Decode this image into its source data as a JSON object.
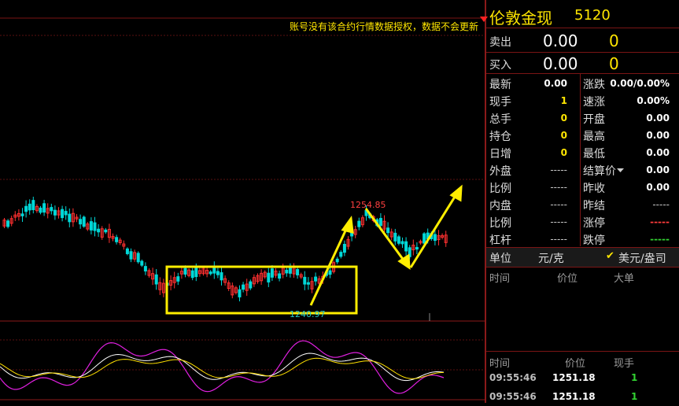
{
  "notice": "账号没有该合约行情数据授权，数据不会更新",
  "annotations": {
    "high_price": "1254.85",
    "low_price": "1240.97"
  },
  "quote": {
    "name": "伦敦金现",
    "code": "5120",
    "sell_label": "卖出",
    "sell_price": "0.00",
    "sell_volume": "0",
    "buy_label": "买入",
    "buy_price": "0.00",
    "buy_volume": "0"
  },
  "stats_left": [
    {
      "label": "最新",
      "value": "0.00",
      "color": "white"
    },
    {
      "label": "现手",
      "value": "1",
      "color": "yellow"
    },
    {
      "label": "总手",
      "value": "0",
      "color": "yellow"
    },
    {
      "label": "持仓",
      "value": "0",
      "color": "yellow"
    },
    {
      "label": "日增",
      "value": "0",
      "color": "yellow"
    },
    {
      "label": "外盘",
      "value": "-----",
      "color": "dash"
    },
    {
      "label": "比例",
      "value": "-----",
      "color": "dash"
    },
    {
      "label": "内盘",
      "value": "-----",
      "color": "dash"
    },
    {
      "label": "比例",
      "value": "-----",
      "color": "dash"
    },
    {
      "label": "杠杆",
      "value": "-----",
      "color": "dash"
    }
  ],
  "stats_right": [
    {
      "label": "涨跌",
      "value": "0.00/0.00%",
      "color": "white"
    },
    {
      "label": "速涨",
      "value": "0.00%",
      "color": "white"
    },
    {
      "label": "开盘",
      "value": "0.00",
      "color": "white"
    },
    {
      "label": "最高",
      "value": "0.00",
      "color": "white"
    },
    {
      "label": "最低",
      "value": "0.00",
      "color": "white"
    },
    {
      "label": "结算价",
      "value": "0.00",
      "color": "white"
    },
    {
      "label": "昨收",
      "value": "0.00",
      "color": "white"
    },
    {
      "label": "昨结",
      "value": "-----",
      "color": "dash"
    },
    {
      "label": "涨停",
      "value": "-----",
      "color": "red"
    },
    {
      "label": "跌停",
      "value": "-----",
      "color": "green"
    }
  ],
  "unit": {
    "label": "单位",
    "option1": "元/克",
    "option2": "美元/盎司",
    "checked": "✔"
  },
  "tick_header": {
    "col1": "时间",
    "col2": "价位",
    "col3": "大单"
  },
  "trades_header": {
    "col1": "时间",
    "col2": "价位",
    "col3": "现手"
  },
  "trades": [
    {
      "time": "09:55:46",
      "price": "1251.18",
      "volume": "1"
    },
    {
      "time": "09:55:46",
      "price": "1251.18",
      "volume": "1"
    }
  ],
  "colors": {
    "bull": "#ff3030",
    "bear": "#00d8d8",
    "highlight": "#ffee00",
    "grid": "#8b1a1a",
    "osc_fast": "#e020e0",
    "osc_mid": "#ffffff",
    "osc_slow": "#ffe000"
  }
}
